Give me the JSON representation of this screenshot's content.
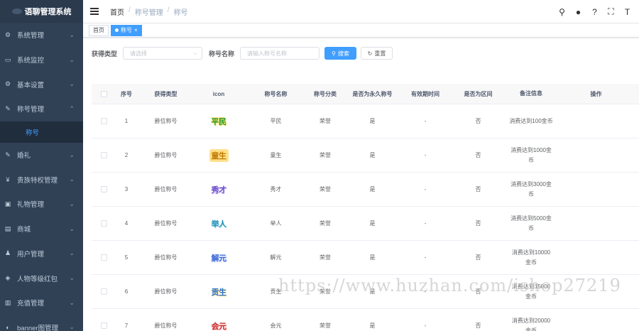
{
  "app": {
    "title": "语聊管理系统"
  },
  "sidebar": {
    "items": [
      {
        "label": "系统管理",
        "icon": "gear-icon",
        "glyph": "⚙"
      },
      {
        "label": "系统监控",
        "icon": "monitor-icon",
        "glyph": "▭"
      },
      {
        "label": "基本设置",
        "icon": "settings-icon",
        "glyph": "⚙"
      },
      {
        "label": "称号管理",
        "icon": "edit-icon",
        "glyph": "✎",
        "expanded": true
      },
      {
        "label": "称号",
        "icon": "",
        "submenu": true,
        "active": true
      },
      {
        "label": "婚礼",
        "icon": "edit-icon",
        "glyph": "✎"
      },
      {
        "label": "贵族特权管理",
        "icon": "yen-icon",
        "glyph": "¥"
      },
      {
        "label": "礼物管理",
        "icon": "gift-icon",
        "glyph": "▣"
      },
      {
        "label": "商城",
        "icon": "shop-icon",
        "glyph": "▤"
      },
      {
        "label": "用户管理",
        "icon": "user-icon",
        "glyph": "♟"
      },
      {
        "label": "人物等级红包",
        "icon": "redpacket-icon",
        "glyph": "◈"
      },
      {
        "label": "充值管理",
        "icon": "chart-icon",
        "glyph": "▥"
      },
      {
        "label": "banner图管理",
        "icon": "image-icon",
        "glyph": "◐"
      }
    ]
  },
  "breadcrumb": [
    "首页",
    "称号管理",
    "称号"
  ],
  "tags": [
    {
      "label": "首页",
      "active": false
    },
    {
      "label": "称号",
      "active": true
    }
  ],
  "filter": {
    "type_label": "获得类型",
    "type_placeholder": "请选择",
    "name_label": "称号名称",
    "name_placeholder": "请输入称号名称",
    "search_label": "搜索",
    "reset_label": "重置"
  },
  "table": {
    "headers": [
      "序号",
      "获得类型",
      "icon",
      "称号名称",
      "称号分类",
      "是否为永久称号",
      "有效期时间",
      "是否为区间",
      "备注信息",
      "操作"
    ],
    "rows": [
      {
        "index": "1",
        "type": "爵位称号",
        "icon_text": "平民",
        "name": "平民",
        "category": "荣誉",
        "permanent": "是",
        "validity": "-",
        "range": "否",
        "remark": "消费达到100金币"
      },
      {
        "index": "2",
        "type": "爵位称号",
        "icon_text": "童生",
        "name": "童生",
        "category": "荣誉",
        "permanent": "是",
        "validity": "-",
        "range": "否",
        "remark": "消费达到1000金币"
      },
      {
        "index": "3",
        "type": "爵位称号",
        "icon_text": "秀才",
        "name": "秀才",
        "category": "荣誉",
        "permanent": "是",
        "validity": "-",
        "range": "否",
        "remark": "消费达到3000金币"
      },
      {
        "index": "4",
        "type": "爵位称号",
        "icon_text": "举人",
        "name": "举人",
        "category": "荣誉",
        "permanent": "是",
        "validity": "-",
        "range": "否",
        "remark": "消费达到5000金币"
      },
      {
        "index": "5",
        "type": "爵位称号",
        "icon_text": "解元",
        "name": "解元",
        "category": "荣誉",
        "permanent": "是",
        "validity": "-",
        "range": "否",
        "remark": "消费达到10000金币"
      },
      {
        "index": "6",
        "type": "爵位称号",
        "icon_text": "贡生",
        "name": "贡生",
        "category": "荣誉",
        "permanent": "是",
        "validity": "-",
        "range": "否",
        "remark": "消费达到15000金币"
      },
      {
        "index": "7",
        "type": "爵位称号",
        "icon_text": "会元",
        "name": "会元",
        "category": "荣誉",
        "permanent": "是",
        "validity": "-",
        "range": "否",
        "remark": "消费达到20000金币"
      }
    ]
  },
  "watermark": "https://www.huzhan.com/ishop27219"
}
